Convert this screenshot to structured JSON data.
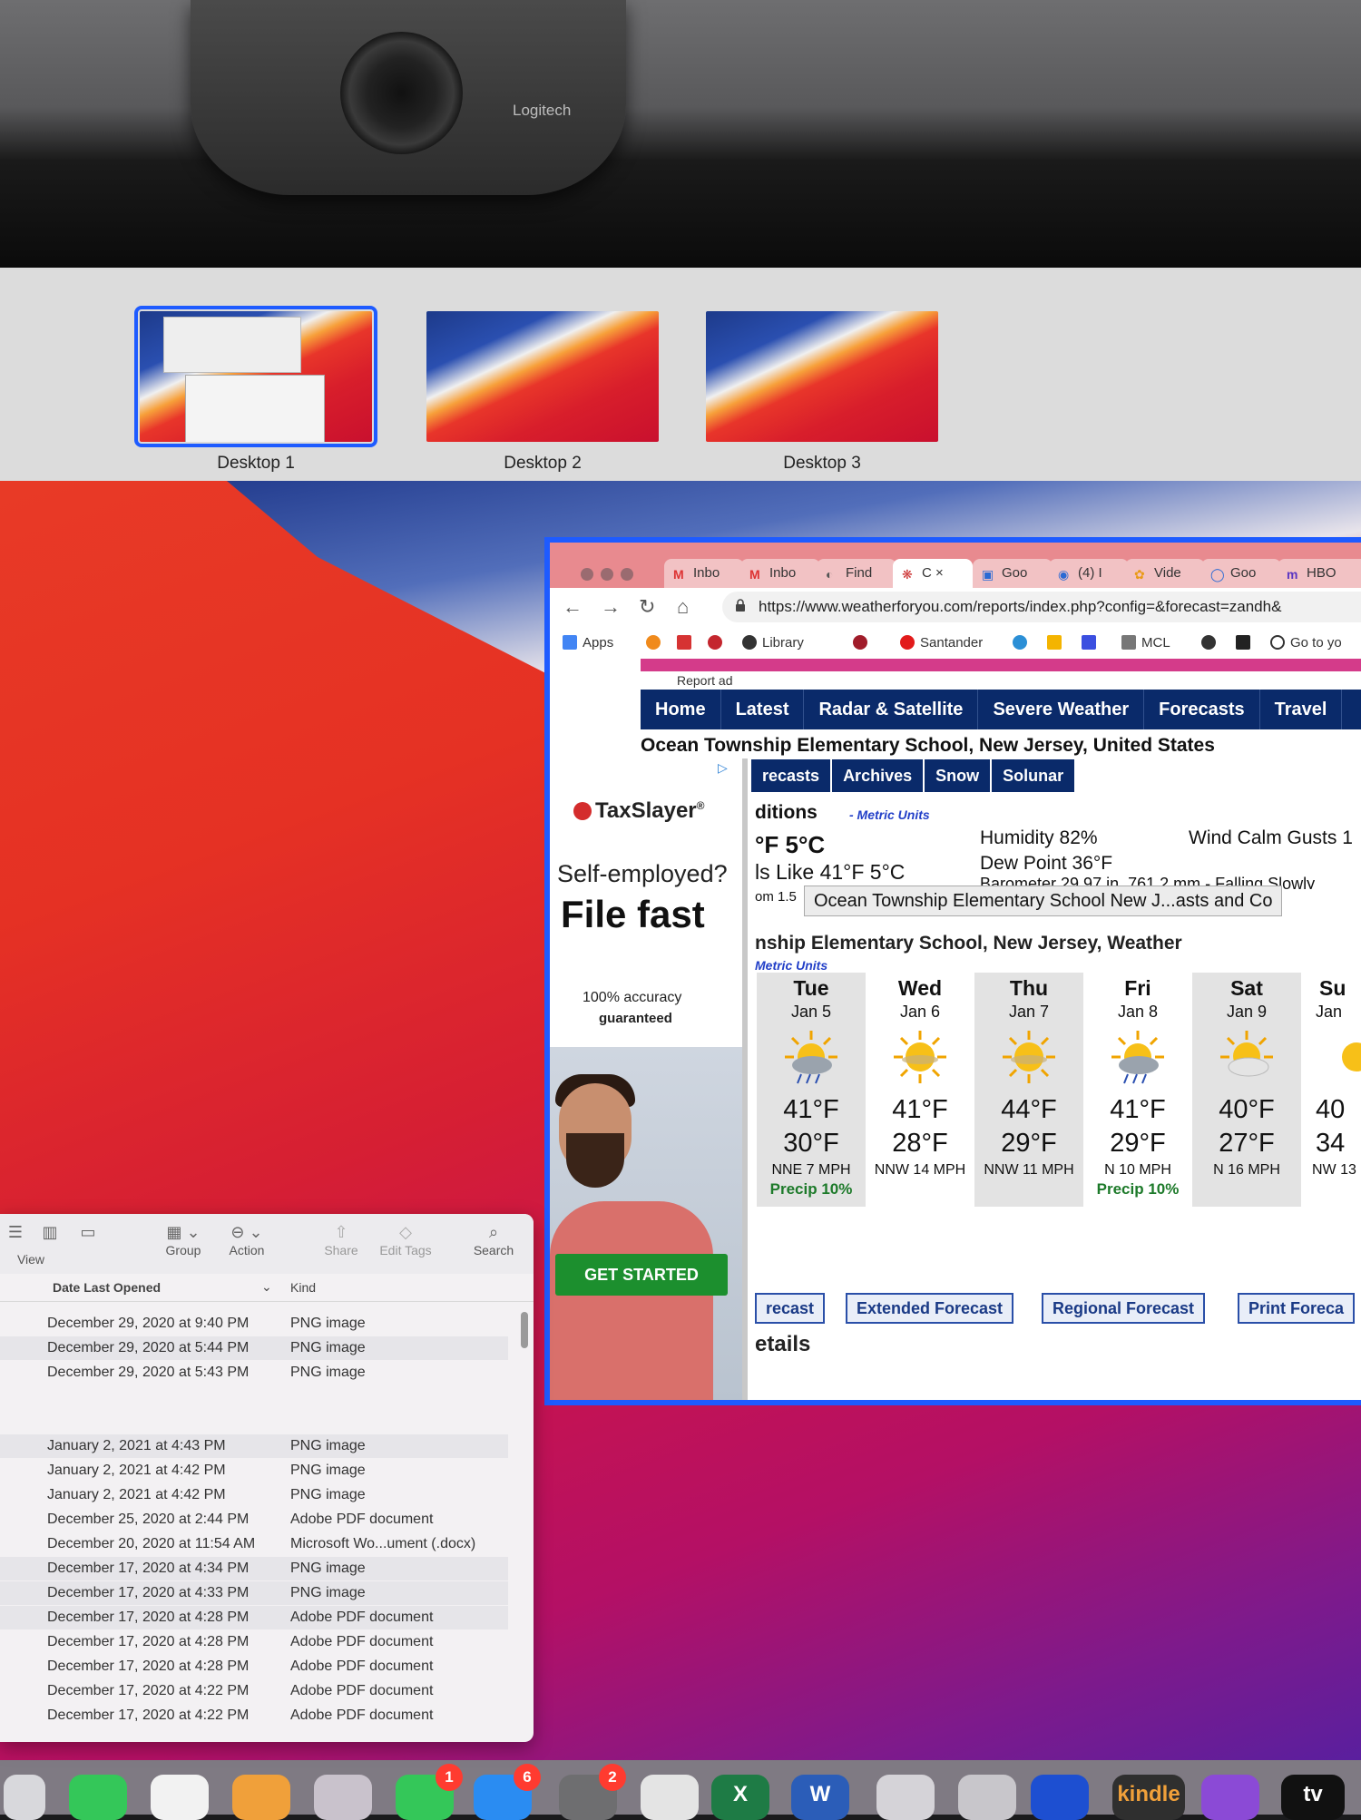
{
  "webcam": {
    "brand": "Logitech"
  },
  "spaces": [
    "Desktop 1",
    "Desktop 2",
    "Desktop 3"
  ],
  "browser": {
    "tabs": [
      {
        "label": "Inbo",
        "icon": "gmail-icon",
        "fav": "M"
      },
      {
        "label": "Inbo",
        "icon": "gmail-icon",
        "fav": "M"
      },
      {
        "label": "Find",
        "icon": "shield-icon",
        "fav": "◐"
      },
      {
        "label": "C",
        "icon": "weather-icon",
        "fav": "❋",
        "active": true
      },
      {
        "label": "Goo",
        "icon": "doc-icon",
        "fav": "▣"
      },
      {
        "label": "(4) I",
        "icon": "chat-icon",
        "fav": "◉"
      },
      {
        "label": "Vide",
        "icon": "pinwheel-icon",
        "fav": "✿"
      },
      {
        "label": "Goo",
        "icon": "circle-icon",
        "fav": "◯"
      },
      {
        "label": "HBO",
        "icon": "m-icon",
        "fav": "m"
      }
    ],
    "tab_close": "×",
    "url": "https://www.weatherforyou.com/reports/index.php?config=&forecast=zandh&",
    "bookmarks": [
      "Apps",
      "Library",
      "Santander",
      "MCL",
      "Go to yo"
    ]
  },
  "weather": {
    "report_ad": "Report ad",
    "nav": [
      "Home",
      "Latest",
      "Radar & Satellite",
      "Severe Weather",
      "Forecasts",
      "Travel"
    ],
    "location": "Ocean Township Elementary School, New Jersey, United States",
    "subnav": [
      "recasts",
      "Archives",
      "Snow",
      "Solunar"
    ],
    "conditions_title": "ditions",
    "metric_units": "- Metric Units",
    "temp": "°F  5°C",
    "feels_like": "ls Like 41°F  5°C",
    "humidity": "Humidity 82%",
    "dew_point": "Dew Point 36°F",
    "wind": "Wind Calm Gusts 1",
    "barometer": "Barometer 29.97 in.  761.2 mm - Falling Slowly",
    "visibility": "om 1.5",
    "tooltip": "Ocean Township Elementary School New J...asts and Co",
    "forecast_title": "nship Elementary School, New Jersey, Weather",
    "forecast_metric": "Metric Units",
    "days": [
      {
        "name": "Tue",
        "date": "Jan 5",
        "hi": "41°F",
        "lo": "30°F",
        "wind": "NNE 7 MPH",
        "precip": "Precip 10%",
        "icon": "rain-sun-icon"
      },
      {
        "name": "Wed",
        "date": "Jan 6",
        "hi": "41°F",
        "lo": "28°F",
        "wind": "NNW 14 MPH",
        "precip": "",
        "icon": "sun-icon"
      },
      {
        "name": "Thu",
        "date": "Jan 7",
        "hi": "44°F",
        "lo": "29°F",
        "wind": "NNW 11 MPH",
        "precip": "",
        "icon": "sun-icon"
      },
      {
        "name": "Fri",
        "date": "Jan 8",
        "hi": "41°F",
        "lo": "29°F",
        "wind": "N 10 MPH",
        "precip": "Precip 10%",
        "icon": "rain-sun-icon"
      },
      {
        "name": "Sat",
        "date": "Jan 9",
        "hi": "40°F",
        "lo": "27°F",
        "wind": "N 16 MPH",
        "precip": "",
        "icon": "cloud-sun-icon"
      },
      {
        "name": "Su",
        "date": "Jan",
        "hi": "40",
        "lo": "34",
        "wind": "NW 13",
        "precip": "",
        "icon": "sun-icon"
      }
    ],
    "buttons": [
      "recast",
      "Extended Forecast",
      "Regional Forecast",
      "Print Foreca"
    ],
    "details": "etails"
  },
  "ad": {
    "brand": "TaxSlayer",
    "reg": "®",
    "headline1": "Self-employed?",
    "headline2": "File fast",
    "line3": "100% accuracy",
    "line4": "guaranteed",
    "cta": "GET STARTED"
  },
  "finder": {
    "toolbar": [
      "View",
      "Group",
      "Action",
      "Share",
      "Edit Tags",
      "Search"
    ],
    "columns": [
      "Date Last Opened",
      "Kind"
    ],
    "rows": [
      {
        "date": "December 29, 2020 at 9:40 PM",
        "kind": "PNG image"
      },
      {
        "date": "December 29, 2020 at 5:44 PM",
        "kind": "PNG image"
      },
      {
        "date": "December 29, 2020 at 5:43 PM",
        "kind": "PNG image"
      },
      {
        "date": "",
        "kind": ""
      },
      {
        "date": "",
        "kind": ""
      },
      {
        "date": "January 2, 2021 at 4:43 PM",
        "kind": "PNG image"
      },
      {
        "date": "January 2, 2021 at 4:42 PM",
        "kind": "PNG image"
      },
      {
        "date": "January 2, 2021 at 4:42 PM",
        "kind": "PNG image"
      },
      {
        "date": "December 25, 2020 at 2:44 PM",
        "kind": "Adobe PDF document"
      },
      {
        "date": "December 20, 2020 at 11:54 AM",
        "kind": "Microsoft Wo...ument (.docx)"
      },
      {
        "date": "December 17, 2020 at 4:34 PM",
        "kind": "PNG image"
      },
      {
        "date": "December 17, 2020 at 4:33 PM",
        "kind": "PNG image"
      },
      {
        "date": "December 17, 2020 at 4:28 PM",
        "kind": "Adobe PDF document"
      },
      {
        "date": "December 17, 2020 at 4:28 PM",
        "kind": "Adobe PDF document"
      },
      {
        "date": "December 17, 2020 at 4:28 PM",
        "kind": "Adobe PDF document"
      },
      {
        "date": "December 17, 2020 at 4:22 PM",
        "kind": "Adobe PDF document"
      },
      {
        "date": "December 17, 2020 at 4:22 PM",
        "kind": "Adobe PDF document"
      }
    ]
  },
  "dock": {
    "badges": [
      "1",
      "6",
      "2"
    ],
    "kindle": "kindle",
    "tv": "tv",
    "excel": "X",
    "word": "W"
  }
}
